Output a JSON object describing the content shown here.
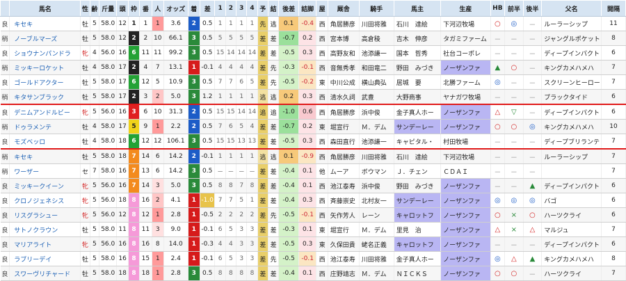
{
  "columns": [
    "",
    "馬名",
    "性",
    "齢",
    "斤量",
    "頭",
    "枠",
    "番",
    "人",
    "オッズ",
    "着",
    "差",
    "1",
    "2",
    "3",
    "4",
    "予",
    "結",
    "後差",
    "詰脚",
    "屋",
    "厩舎",
    "騎手",
    "馬主",
    "生産",
    "HB",
    "前半",
    "後半",
    "父名",
    "開隔"
  ],
  "colors": {
    "header_bg": "#d6e4f2",
    "separator": "#e01818",
    "waku_1": "#ffffff",
    "waku_2": "#222222",
    "waku_3": "#e02020",
    "waku_4": "#1f5fd6",
    "waku_5": "#f0d21a",
    "waku_6": "#23a235",
    "waku_7": "#f38b1e",
    "waku_8": "#f59ad8",
    "tyaku_1": "#d61b1b",
    "tyaku_2": "#1c5cc7",
    "tyaku_3": "#2a8a3a",
    "tyaku_other": "#4a4a4a",
    "mark_red": "#d21f1f",
    "mark_blue": "#1c5cc7",
    "mark_green": "#2a8a3a"
  },
  "rows": [
    {
      "baba": "良",
      "name": "キセキ",
      "sex": "牡",
      "age": "5",
      "kin": "58.0",
      "tou": "12",
      "waku": "1",
      "ban": "1",
      "nin": "1",
      "odds": "3.6",
      "tyaku": "2",
      "sa": "0.5",
      "c1": "1",
      "c2": "1",
      "c3": "1",
      "c4": "1",
      "yo": "先",
      "ke": "逃",
      "gosa": "0.1",
      "tsume": "-0.4",
      "ya": "西",
      "kyu": "角居勝彦",
      "kishu": "川田将雅",
      "owner": "石川　達絵",
      "prod": "下河辺牧場",
      "hb": "○",
      "zen": "◎",
      "kou": "－",
      "sire": "ルーラーシップ",
      "kaku": "11"
    },
    {
      "baba": "稍",
      "name": "ノーブルマーズ",
      "sex": "牡",
      "age": "5",
      "kin": "58.0",
      "tou": "12",
      "waku": "2",
      "ban": "2",
      "nin": "10",
      "odds": "66.1",
      "tyaku": "3",
      "sa": "0.5",
      "c1": "5",
      "c2": "5",
      "c3": "5",
      "c4": "5",
      "yo": "差",
      "ke": "差",
      "gosa": "-0.7",
      "tsume": "0.2",
      "ya": "西",
      "kyu": "宮本博",
      "kishu": "高倉稜",
      "owner": "吉木　伸彦",
      "prod": "タガミファーム",
      "hb": "－",
      "zen": "－",
      "kou": "－",
      "sire": "ジャングルポケット",
      "kaku": "8"
    },
    {
      "baba": "良",
      "name": "ショウナンパンドラ",
      "sex": "牝",
      "age": "4",
      "kin": "56.0",
      "tou": "16",
      "waku": "6",
      "ban": "11",
      "nin": "11",
      "odds": "99.2",
      "tyaku": "3",
      "sa": "0.5",
      "c1": "15",
      "c2": "14",
      "c3": "14",
      "c4": "14",
      "yo": "差",
      "ke": "差",
      "gosa": "-0.5",
      "tsume": "0.3",
      "ya": "西",
      "kyu": "高野友和",
      "kishu": "池添謙一",
      "owner": "国本　哲秀",
      "prod": "社台コーポレ",
      "hb": "－",
      "zen": "－",
      "kou": "－",
      "sire": "ディープインパクト",
      "kaku": "6"
    },
    {
      "baba": "稍",
      "name": "ミッキーロケット",
      "sex": "牡",
      "age": "4",
      "kin": "58.0",
      "tou": "17",
      "waku": "2",
      "ban": "4",
      "nin": "7",
      "odds": "13.1",
      "tyaku": "1",
      "sa": "-0.1",
      "c1": "4",
      "c2": "4",
      "c3": "4",
      "c4": "4",
      "yo": "差",
      "ke": "先",
      "gosa": "-0.3",
      "tsume": "-0.1",
      "ya": "西",
      "kyu": "音無秀孝",
      "kishu": "和田竜二",
      "owner": "野田　みづき",
      "prod": "ノーザンファ",
      "hb": "▲",
      "zen": "○",
      "kou": "－",
      "sire": "キングカメハメハ",
      "kaku": "7"
    },
    {
      "baba": "良",
      "name": "ゴールドアクター",
      "sex": "牡",
      "age": "5",
      "kin": "58.0",
      "tou": "17",
      "waku": "6",
      "ban": "12",
      "nin": "5",
      "odds": "10.9",
      "tyaku": "3",
      "sa": "0.5",
      "c1": "7",
      "c2": "7",
      "c3": "6",
      "c4": "5",
      "yo": "差",
      "ke": "先",
      "gosa": "-0.5",
      "tsume": "-0.2",
      "ya": "東",
      "kyu": "中川公成",
      "kishu": "横山典弘",
      "owner": "居城　要",
      "prod": "北勝ファーム",
      "hb": "◎",
      "zen": "－",
      "kou": "－",
      "sire": "スクリーンヒーロー",
      "kaku": "7"
    },
    {
      "baba": "稍",
      "name": "キタサンブラック",
      "sex": "牡",
      "age": "5",
      "kin": "58.0",
      "tou": "17",
      "waku": "2",
      "ban": "3",
      "nin": "2",
      "odds": "5.0",
      "tyaku": "3",
      "sa": "1.2",
      "c1": "1",
      "c2": "1",
      "c3": "1",
      "c4": "1",
      "yo": "逃",
      "ke": "逃",
      "gosa": "0.2",
      "tsume": "0.3",
      "ya": "西",
      "kyu": "清水久詞",
      "kishu": "武豊",
      "owner": "大野商事",
      "prod": "ヤナガワ牧場",
      "hb": "－",
      "zen": "－",
      "kou": "－",
      "sire": "ブラックタイド",
      "kaku": "6"
    },
    {
      "baba": "良",
      "name": "デニムアンドルビー",
      "sex": "牝",
      "age": "5",
      "kin": "56.0",
      "tou": "16",
      "waku": "3",
      "ban": "6",
      "nin": "10",
      "odds": "31.3",
      "tyaku": "2",
      "sa": "0.5",
      "c1": "15",
      "c2": "15",
      "c3": "14",
      "c4": "14",
      "yo": "追",
      "ke": "追",
      "gosa": "-1.0",
      "tsume": "0.6",
      "ya": "西",
      "kyu": "角居勝彦",
      "kishu": "浜中俊",
      "owner": "金子真人ホー",
      "prod": "ノーザンファ",
      "hb": "△",
      "zen": "▽",
      "kou": "－",
      "sire": "ディープインパクト",
      "kaku": "6"
    },
    {
      "baba": "稍",
      "name": "ドゥラメンテ",
      "sex": "牡",
      "age": "4",
      "kin": "58.0",
      "tou": "17",
      "waku": "5",
      "ban": "9",
      "nin": "1",
      "odds": "2.2",
      "tyaku": "2",
      "sa": "0.5",
      "c1": "7",
      "c2": "6",
      "c3": "5",
      "c4": "4",
      "yo": "差",
      "ke": "差",
      "gosa": "-0.7",
      "tsume": "0.2",
      "ya": "東",
      "kyu": "堀宣行",
      "kishu": "Ｍ．デム",
      "owner": "サンデーレー",
      "prod": "ノーザンファ",
      "hb": "○",
      "zen": "○",
      "kou": "◎",
      "sire": "キングカメハメハ",
      "kaku": "10"
    },
    {
      "baba": "良",
      "name": "モズベッロ",
      "sex": "牡",
      "age": "4",
      "kin": "58.0",
      "tou": "18",
      "waku": "6",
      "ban": "12",
      "nin": "12",
      "odds": "106.1",
      "tyaku": "3",
      "sa": "0.5",
      "c1": "15",
      "c2": "15",
      "c3": "13",
      "c4": "13",
      "yo": "差",
      "ke": "差",
      "gosa": "-0.5",
      "tsume": "0.3",
      "ya": "西",
      "kyu": "森田直行",
      "kishu": "池添謙一",
      "owner": "キャピタル・",
      "prod": "村田牧場",
      "hb": "－",
      "zen": "－",
      "kou": "－",
      "sire": "ディープブリランテ",
      "kaku": "7"
    },
    {
      "baba": "稍",
      "name": "キセキ",
      "sex": "牡",
      "age": "5",
      "kin": "58.0",
      "tou": "18",
      "waku": "7",
      "ban": "14",
      "nin": "6",
      "odds": "14.2",
      "tyaku": "2",
      "sa": "-0.1",
      "c1": "1",
      "c2": "1",
      "c3": "1",
      "c4": "1",
      "yo": "逃",
      "ke": "逃",
      "gosa": "0.1",
      "tsume": "-0.9",
      "ya": "西",
      "kyu": "角居勝彦",
      "kishu": "川田将雅",
      "owner": "石川　達絵",
      "prod": "下河辺牧場",
      "hb": "－",
      "zen": "－",
      "kou": "－",
      "sire": "ルーラーシップ",
      "kaku": "7"
    },
    {
      "baba": "稍",
      "name": "ワーザー",
      "sex": "セ",
      "age": "7",
      "kin": "58.0",
      "tou": "16",
      "waku": "7",
      "ban": "13",
      "nin": "6",
      "odds": "14.2",
      "tyaku": "3",
      "sa": "0.5",
      "c1": "－",
      "c2": "－",
      "c3": "－",
      "c4": "－",
      "yo": "差",
      "ke": "差",
      "gosa": "-0.4",
      "tsume": "0.1",
      "ya": "他",
      "kyu": "ムーア",
      "kishu": "ボウマン",
      "owner": "Ｊ．チェン",
      "prod": "ＣＤＡＩ",
      "hb": "－",
      "zen": "－",
      "kou": "－",
      "sire": "",
      "kaku": "7"
    },
    {
      "baba": "良",
      "name": "ミッキークイーン",
      "sex": "牝",
      "age": "5",
      "kin": "56.0",
      "tou": "16",
      "waku": "7",
      "ban": "14",
      "nin": "3",
      "odds": "5.0",
      "tyaku": "3",
      "sa": "0.5",
      "c1": "8",
      "c2": "8",
      "c3": "7",
      "c4": "8",
      "yo": "差",
      "ke": "差",
      "gosa": "-0.4",
      "tsume": "0.1",
      "ya": "西",
      "kyu": "池江泰寿",
      "kishu": "浜中俊",
      "owner": "野田　みづき",
      "prod": "ノーザンファ",
      "hb": "－",
      "zen": "－",
      "kou": "▲",
      "sire": "ディープインパクト",
      "kaku": "6"
    },
    {
      "baba": "良",
      "name": "クロノジェネシス",
      "sex": "牝",
      "age": "5",
      "kin": "56.0",
      "tou": "18",
      "waku": "8",
      "ban": "16",
      "nin": "2",
      "odds": "4.1",
      "tyaku": "1",
      "sa": "-1.0",
      "c1": "7",
      "c2": "7",
      "c3": "5",
      "c4": "1",
      "yo": "差",
      "ke": "差",
      "gosa": "-0.4",
      "tsume": "0.3",
      "ya": "西",
      "kyu": "斉藤崇史",
      "kishu": "北村友一",
      "owner": "サンデーレー",
      "prod": "ノーザンファ",
      "hb": "◎",
      "zen": "◎",
      "kou": "◎",
      "sire": "バゴ",
      "kaku": "6"
    },
    {
      "baba": "良",
      "name": "リスグラシュー",
      "sex": "牝",
      "age": "5",
      "kin": "56.0",
      "tou": "12",
      "waku": "8",
      "ban": "12",
      "nin": "1",
      "odds": "2.8",
      "tyaku": "1",
      "sa": "-0.5",
      "c1": "2",
      "c2": "2",
      "c3": "2",
      "c4": "2",
      "yo": "差",
      "ke": "先",
      "gosa": "-0.5",
      "tsume": "-0.1",
      "ya": "西",
      "kyu": "矢作芳人",
      "kishu": "レーン",
      "owner": "キャロットフ",
      "prod": "ノーザンファ",
      "hb": "○",
      "zen": "×",
      "kou": "○",
      "sire": "ハーツクライ",
      "kaku": "6"
    },
    {
      "baba": "良",
      "name": "サトノクラウン",
      "sex": "牡",
      "age": "5",
      "kin": "58.0",
      "tou": "11",
      "waku": "8",
      "ban": "11",
      "nin": "3",
      "odds": "9.0",
      "tyaku": "1",
      "sa": "-0.1",
      "c1": "6",
      "c2": "5",
      "c3": "3",
      "c4": "3",
      "yo": "差",
      "ke": "差",
      "gosa": "-0.3",
      "tsume": "0.1",
      "ya": "東",
      "kyu": "堀宣行",
      "kishu": "Ｍ．デム",
      "owner": "里見　治",
      "prod": "ノーザンファ",
      "hb": "△",
      "zen": "×",
      "kou": "△",
      "sire": "マルジュ",
      "kaku": "7"
    },
    {
      "baba": "良",
      "name": "マリアライト",
      "sex": "牝",
      "age": "5",
      "kin": "56.0",
      "tou": "16",
      "waku": "8",
      "ban": "16",
      "nin": "8",
      "odds": "14.0",
      "tyaku": "1",
      "sa": "-0.3",
      "c1": "4",
      "c2": "4",
      "c3": "3",
      "c4": "3",
      "yo": "差",
      "ke": "差",
      "gosa": "-0.5",
      "tsume": "0.3",
      "ya": "東",
      "kyu": "久保田貴",
      "kishu": "蛯名正義",
      "owner": "キャロットフ",
      "prod": "ノーザンファ",
      "hb": "－",
      "zen": "－",
      "kou": "－",
      "sire": "ディープインパクト",
      "kaku": "6"
    },
    {
      "baba": "良",
      "name": "ラブリーデイ",
      "sex": "牡",
      "age": "5",
      "kin": "58.0",
      "tou": "16",
      "waku": "8",
      "ban": "15",
      "nin": "1",
      "odds": "2.4",
      "tyaku": "1",
      "sa": "-0.1",
      "c1": "6",
      "c2": "5",
      "c3": "3",
      "c4": "3",
      "yo": "差",
      "ke": "先",
      "gosa": "-0.5",
      "tsume": "-0.1",
      "ya": "西",
      "kyu": "池江泰寿",
      "kishu": "川田将雅",
      "owner": "金子真人ホー",
      "prod": "ノーザンファ",
      "hb": "◎",
      "zen": "△",
      "kou": "▲",
      "sire": "キングカメハメハ",
      "kaku": "8"
    },
    {
      "baba": "良",
      "name": "スワーヴリチャード",
      "sex": "牡",
      "age": "5",
      "kin": "58.0",
      "tou": "18",
      "waku": "8",
      "ban": "18",
      "nin": "1",
      "odds": "2.8",
      "tyaku": "3",
      "sa": "0.5",
      "c1": "8",
      "c2": "8",
      "c3": "8",
      "c4": "8",
      "yo": "差",
      "ke": "差",
      "gosa": "-0.4",
      "tsume": "0.1",
      "ya": "西",
      "kyu": "庄野靖志",
      "kishu": "Ｍ．デム",
      "owner": "ＮＩＣＫＳ",
      "prod": "ノーザンファ",
      "hb": "○",
      "zen": "○",
      "kou": "－",
      "sire": "ハーツクライ",
      "kaku": "7"
    }
  ]
}
